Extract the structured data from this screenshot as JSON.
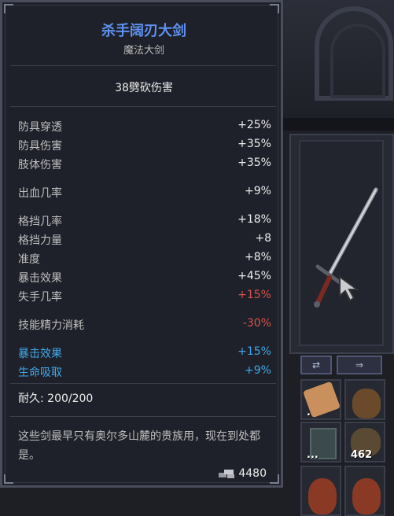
{
  "tooltip": {
    "name": "杀手阔刃大剑",
    "type": "魔法大剑",
    "damage": "38劈砍伤害",
    "stats_group1": [
      {
        "label": "防具穿透",
        "value": "+25%"
      },
      {
        "label": "防具伤害",
        "value": "+35%"
      },
      {
        "label": "肢体伤害",
        "value": "+35%"
      }
    ],
    "stats_group2": [
      {
        "label": "出血几率",
        "value": "+9%"
      }
    ],
    "stats_group3": [
      {
        "label": "格挡几率",
        "value": "+18%"
      },
      {
        "label": "格挡力量",
        "value": "+8"
      },
      {
        "label": "准度",
        "value": "+8%"
      },
      {
        "label": "暴击效果",
        "value": "+45%"
      },
      {
        "label": "失手几率",
        "value": "+15%"
      }
    ],
    "stats_group4": [
      {
        "label": "技能精力消耗",
        "value": "-30%"
      }
    ],
    "stats_magic": [
      {
        "label": "暴击效果",
        "value": "+15%"
      },
      {
        "label": "生命吸取",
        "value": "+9%"
      }
    ],
    "durability": "耐久: 200/200",
    "description": "这些剑最早只有奥尔多山麓的贵族用，现在到处都是。",
    "price": "4480"
  },
  "inventory": {
    "slot_counts": [
      ".",
      "...",
      "462"
    ]
  },
  "colors": {
    "title": "#5f92f2",
    "magic_stat": "#41a8e8",
    "negative_stat": "#d9534c"
  },
  "icons": [
    "sword-icon",
    "swap-weapon-icon",
    "arrow-icon",
    "coins-icon",
    "scroll-icon",
    "sack-icon"
  ]
}
